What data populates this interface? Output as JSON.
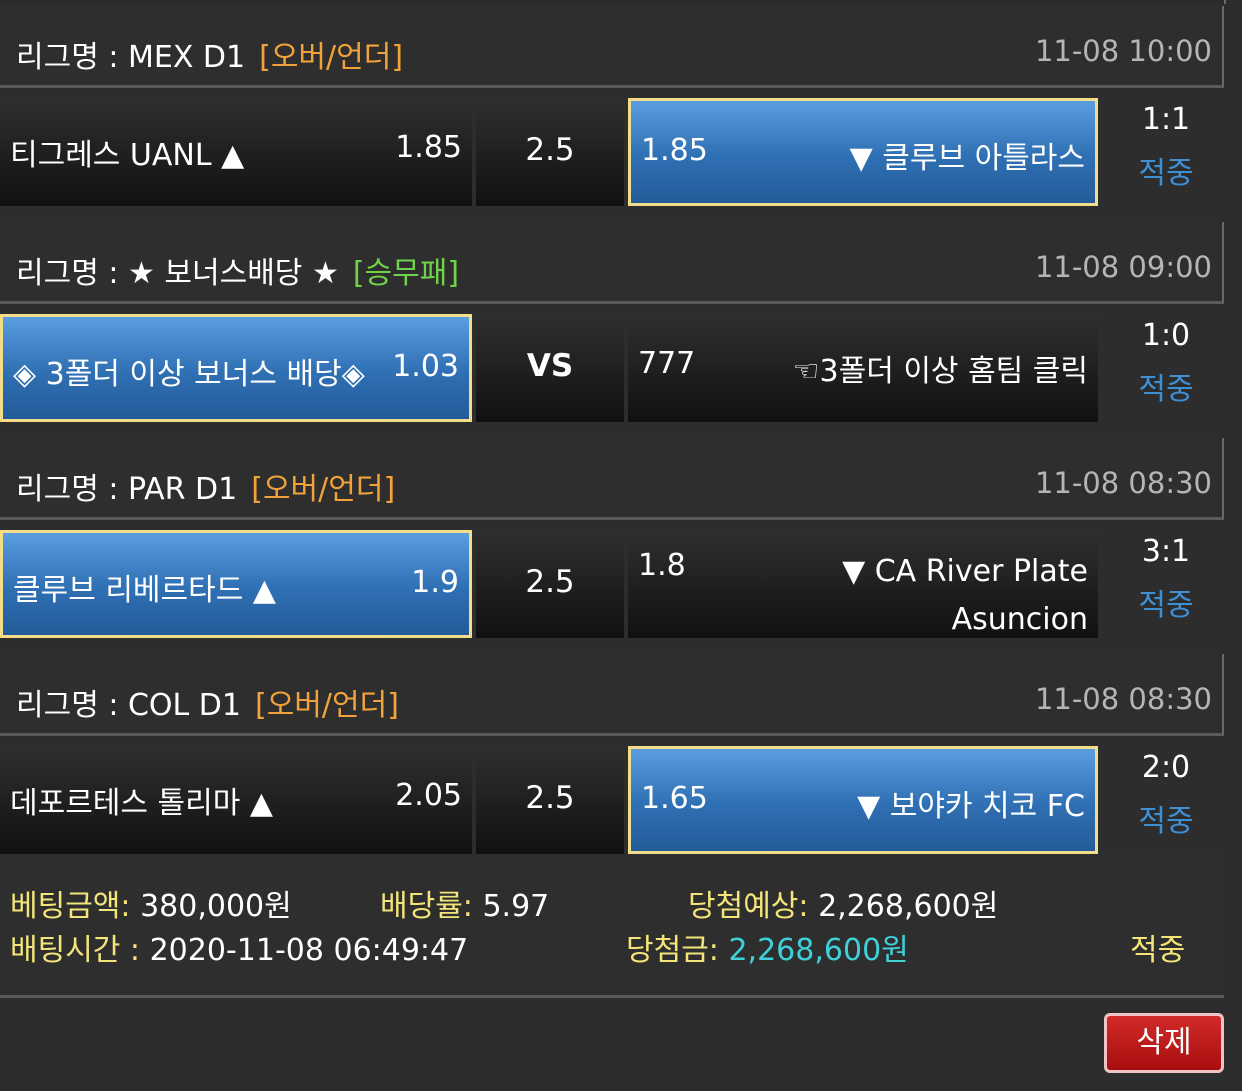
{
  "games": [
    {
      "league_label": "리그명 : MEX D1",
      "bet_type": "[오버/언더]",
      "bet_type_kind": "ou",
      "time": "11-08 10:00",
      "home_team": "티그레스 UANL ▲",
      "home_odds": "1.85",
      "mid": "2.5",
      "away_odds": "1.85",
      "away_team": "▼ 클루브 아틀라스",
      "selected": "away",
      "score": "1:1",
      "result": "적중"
    },
    {
      "league_label": "리그명 : ★ 보너스배당 ★",
      "bet_type": "[승무패]",
      "bet_type_kind": "wdl",
      "time": "11-08 09:00",
      "home_team": "◈ 3폴더 이상 보너스 배당◈",
      "home_odds": "1.03",
      "mid": "VS",
      "away_odds": "777",
      "away_team": "☜3폴더 이상 홈팀 클릭",
      "selected": "home",
      "score": "1:0",
      "result": "적중"
    },
    {
      "league_label": "리그명 : PAR D1",
      "bet_type": "[오버/언더]",
      "bet_type_kind": "ou",
      "time": "11-08 08:30",
      "home_team": "클루브 리베르타드 ▲",
      "home_odds": "1.9",
      "mid": "2.5",
      "away_odds": "1.8",
      "away_team_line1": "▼ CA River Plate",
      "away_team_line2": "Asuncion",
      "selected": "home",
      "score": "3:1",
      "result": "적중"
    },
    {
      "league_label": "리그명 : COL D1",
      "bet_type": "[오버/언더]",
      "bet_type_kind": "ou",
      "time": "11-08 08:30",
      "home_team": "데포르테스 톨리마 ▲",
      "home_odds": "2.05",
      "mid": "2.5",
      "away_odds": "1.65",
      "away_team": "▼ 보야카 치코 FC",
      "selected": "away",
      "score": "2:0",
      "result": "적중"
    }
  ],
  "summary": {
    "bet_amount_label": "베팅금액:",
    "bet_amount": "380,000원",
    "odds_label": "배당률:",
    "odds": "5.97",
    "expected_label": "당첨예상:",
    "expected": "2,268,600원",
    "bet_time_label": "배팅시간 :",
    "bet_time": "2020-11-08 06:49:47",
    "win_label": "당첨금:",
    "win_amount": "2,268,600원",
    "status": "적중"
  },
  "buttons": {
    "delete": "삭제"
  },
  "colors": {
    "selected_blue": "#2f6fb3",
    "selected_border": "#f3dc8a",
    "over_under_orange": "#f2a23a",
    "win_draw_loss_green": "#6fd34a",
    "result_blue": "#3d8fd6",
    "label_yellow": "#f3e57a",
    "win_amount_cyan": "#3fd0d8",
    "delete_red": "#c01c1c"
  }
}
